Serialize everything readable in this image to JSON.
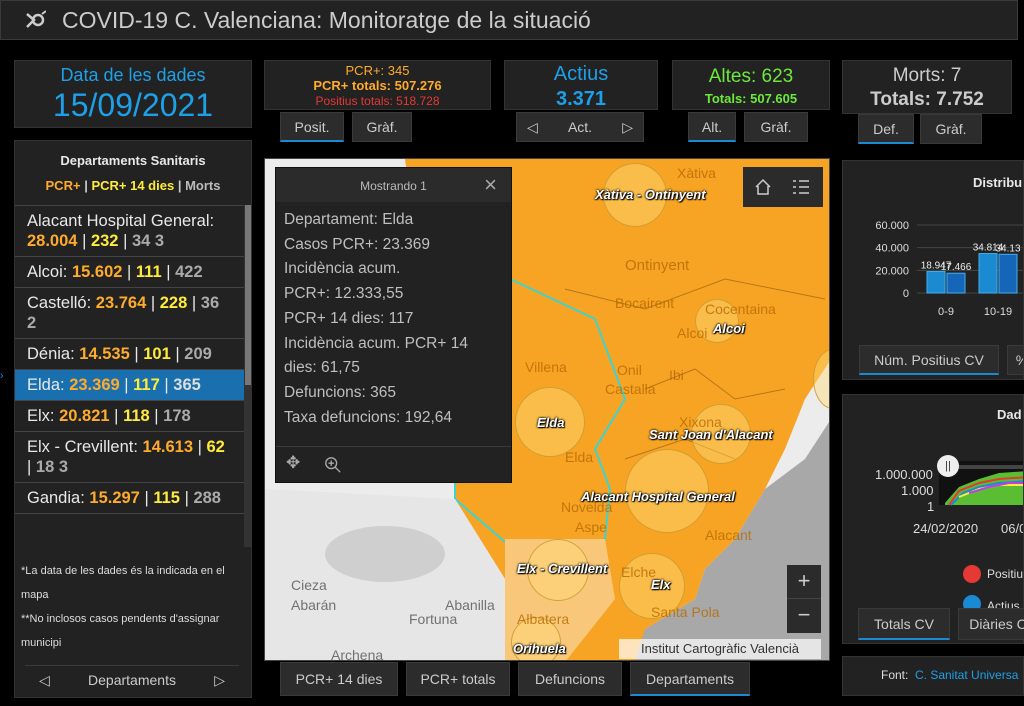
{
  "title": "COVID-19 C. Valenciana: Monitoratge de la situació",
  "date_panel": {
    "label": "Data de les dades",
    "value": "15/09/2021"
  },
  "pcr_panel": {
    "pcr": "PCR+: 345",
    "pcr_totals": "PCR+ totals: 507.276",
    "positius_totals": "Positius totals: 518.728"
  },
  "pcr_tabs": [
    "Posit.",
    "Gràf."
  ],
  "actius_panel": {
    "label": "Actius",
    "value": "3.371",
    "nav_label": "Act."
  },
  "altes_panel": {
    "label": "Altes: 623",
    "totals": "Totals: 507.605"
  },
  "altes_tabs": [
    "Alt.",
    "Gràf."
  ],
  "morts_panel": {
    "label": "Morts: 7",
    "totals": "Totals: 7.752"
  },
  "morts_tabs": [
    "Def.",
    "Gràf."
  ],
  "departments_panel": {
    "title": "Departaments Sanitaris",
    "legend_pcr": "PCR+",
    "legend_pcr14": "PCR+ 14 dies",
    "legend_morts": "Morts",
    "sep": "|",
    "rows": [
      {
        "name": "Alacant Hospital General:",
        "a": "28.004",
        "b": "232",
        "c": "34 3"
      },
      {
        "name": "Alcoi:",
        "a": "15.602",
        "b": "111",
        "c": "422"
      },
      {
        "name": "Castelló:",
        "a": "23.764",
        "b": "228",
        "c": "36 2"
      },
      {
        "name": "Dénia:",
        "a": "14.535",
        "b": "101",
        "c": "209"
      },
      {
        "name": "Elda:",
        "a": "23.369",
        "b": "117",
        "c": "365"
      },
      {
        "name": "Elx:",
        "a": "20.821",
        "b": "118",
        "c": "178"
      },
      {
        "name": "Elx - Crevillent:",
        "a": "14.613",
        "b": "62",
        "c": "18 3"
      },
      {
        "name": "Gandia:",
        "a": "15.297",
        "b": "115",
        "c": "288"
      }
    ],
    "notes": [
      "*La data de les dades és la indicada en el mapa",
      "**No inclosos casos pendents d'assignar municipi"
    ],
    "nav_label": "Departaments"
  },
  "popup": {
    "header": "Mostrando 1",
    "lines": [
      "Departament: Elda",
      "Casos PCR+: 23.369",
      "Incidència acum.",
      "PCR+: 12.333,55",
      "PCR+ 14 dies: 117",
      "Incidència acum. PCR+ 14",
      "dies: 61,75",
      "Defuncions: 365",
      "Taxa defuncions: 192,64"
    ]
  },
  "map": {
    "dept_labels": [
      "Xàtiva - Ontinyent",
      "Alcoi",
      "Elda",
      "Sant Joan d'Alacant",
      "Alacant Hospital General",
      "Elx - Crevillent",
      "Elx",
      "Orihuela"
    ],
    "place_names": [
      "Xàtiva",
      "Ontinyent",
      "Bocairent",
      "Cocentaina",
      "Alcoi",
      "Villena",
      "Onil",
      "Castalla",
      "Ibi",
      "Xixona",
      "Elda",
      "Novelda",
      "Aspe",
      "Elche",
      "Alacant",
      "Santa Pola",
      "Albatera",
      "Cieza",
      "Abarán",
      "Abanilla",
      "Fortuna",
      "Archena"
    ],
    "attribution": "Institut Cartogràfic Valencià",
    "zoom_in": "+",
    "zoom_out": "−"
  },
  "bottom_tabs": [
    "PCR+ 14 dies",
    "PCR+ totals",
    "Defuncions",
    "Departaments"
  ],
  "distribution_panel": {
    "title": "Distribu",
    "tabs": [
      "Núm. Positius CV"
    ],
    "chart_data": {
      "type": "bar",
      "categories": [
        "0-9",
        "10-19"
      ],
      "series": [
        {
          "values": [
            18947,
            34814
          ]
        },
        {
          "values": [
            17466,
            34137
          ]
        }
      ],
      "data_labels": [
        "18.947",
        "17.466",
        "34.814",
        "34.13"
      ],
      "yticks": [
        "60.000",
        "40.000",
        "20.000",
        "0"
      ],
      "ylim": [
        0,
        60000
      ]
    }
  },
  "dades_panel": {
    "title": "Dad",
    "y_ticks": [
      "1.000.000",
      "1.000",
      "1"
    ],
    "x_ticks": [
      "24/02/2020",
      "06/0"
    ],
    "legend": [
      "Positiu",
      "Actius"
    ],
    "tabs": [
      "Totals CV",
      "Diàries C"
    ]
  },
  "font_panel": {
    "label": "Font:",
    "link": "C. Sanitat Universa"
  },
  "colors": {
    "orange": "#ffab2b",
    "yellow": "#ffeb3b",
    "blue": "#1a8ad4",
    "green": "#6ee83a",
    "red": "#e53935",
    "bar": "#1b7fc4"
  }
}
